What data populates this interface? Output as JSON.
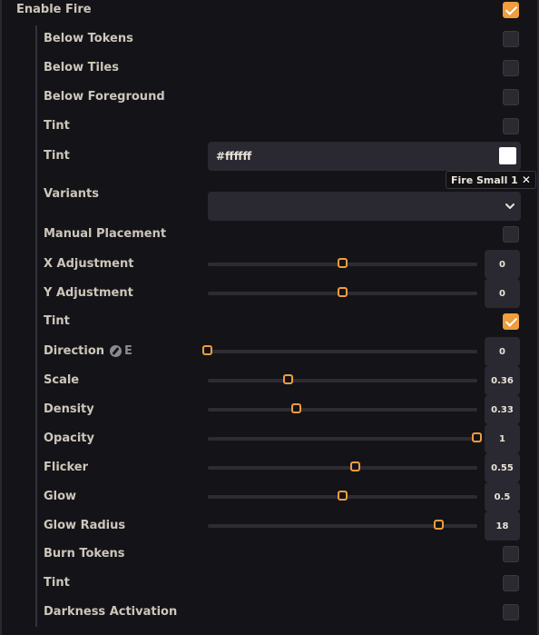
{
  "enable_fire": {
    "label": "Enable Fire",
    "checked": true
  },
  "below_tokens": {
    "label": "Below Tokens",
    "checked": false
  },
  "below_tiles": {
    "label": "Below Tiles",
    "checked": false
  },
  "below_foreground": {
    "label": "Below Foreground",
    "checked": false
  },
  "tint_toggle": {
    "label": "Tint",
    "checked": false
  },
  "tint_color": {
    "label": "Tint",
    "value": "#ffffff",
    "swatch": "#ffffff"
  },
  "variants": {
    "label": "Variants",
    "tag": "Fire Small 1",
    "tag_remove_icon": "close-icon",
    "selected": ""
  },
  "manual_placement": {
    "label": "Manual Placement",
    "checked": false
  },
  "x_adjustment": {
    "label": "X Adjustment",
    "value": "0",
    "position_fraction": 0.5
  },
  "y_adjustment": {
    "label": "Y Adjustment",
    "value": "0",
    "position_fraction": 0.5
  },
  "tint_toggle_2": {
    "label": "Tint",
    "checked": true
  },
  "direction": {
    "label": "Direction",
    "letter": "E",
    "icon": "compass-icon",
    "value": "0",
    "position_fraction": 0.0
  },
  "scale": {
    "label": "Scale",
    "value": "0.36",
    "position_fraction": 0.3
  },
  "density": {
    "label": "Density",
    "value": "0.33",
    "position_fraction": 0.33
  },
  "opacity": {
    "label": "Opacity",
    "value": "1",
    "position_fraction": 1.0
  },
  "flicker": {
    "label": "Flicker",
    "value": "0.55",
    "position_fraction": 0.55
  },
  "glow": {
    "label": "Glow",
    "value": "0.5",
    "position_fraction": 0.5
  },
  "glow_radius": {
    "label": "Glow Radius",
    "value": "18",
    "position_fraction": 0.86
  },
  "burn_tokens": {
    "label": "Burn Tokens",
    "checked": false
  },
  "tint_toggle_3": {
    "label": "Tint",
    "checked": false
  },
  "darkness_activation": {
    "label": "Darkness Activation",
    "checked": false
  },
  "colors": {
    "accent": "#ef9d3d",
    "background": "#141318",
    "field": "#2a2830"
  }
}
